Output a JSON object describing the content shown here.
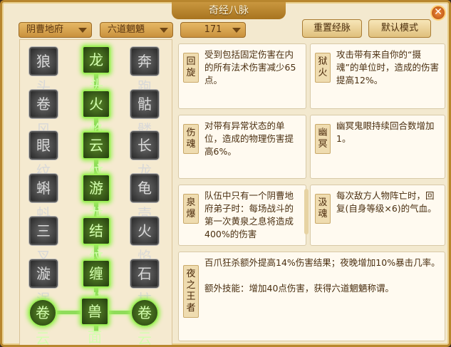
{
  "window": {
    "title": "奇经八脉",
    "close": "✕"
  },
  "filters": {
    "faction": "阴曹地府",
    "path": "六道魍魉",
    "points": "171"
  },
  "buttons": {
    "reset": "重置经脉",
    "default_mode": "默认模式"
  },
  "tree": {
    "left": [
      "狼头",
      "卷风",
      "眼纹",
      "蝌蚪",
      "三叉",
      "漩涡",
      "卷云"
    ],
    "center": [
      "龙头",
      "火焰",
      "云纹",
      "游龙",
      "结纹",
      "缠龙",
      "兽面"
    ],
    "right": [
      "奔跑",
      "骷髅",
      "长龙",
      "龟壳",
      "火焰",
      "石柱",
      "卷云"
    ]
  },
  "cards": [
    {
      "tag": "回旋",
      "text": "受到包括固定伤害在内的所有法术伤害减少65点。"
    },
    {
      "tag": "狱火",
      "text": "攻击带有来自你的“摄魂”的单位时，造成的伤害提高12%。"
    },
    {
      "tag": "伤魂",
      "text": "对带有异常状态的单位，造成的物理伤害提高6%。"
    },
    {
      "tag": "幽冥",
      "text": "幽冥鬼眼持续回合数增加1。"
    },
    {
      "tag": "泉爆",
      "text": "队伍中只有一个阴曹地府弟子时：每场战斗的第一次黄泉之息将造成400%的伤害"
    },
    {
      "tag": "汲魂",
      "text": "每次敌方人物阵亡时，回复(自身等级×6)的气血。"
    },
    {
      "tag": "夜之王者",
      "text": "百爪狂杀额外提高14%伤害结果；夜晚增加10%暴击几率。",
      "extra": "额外技能：增加40点伤害，获得六道魍魉称谓。"
    }
  ]
}
